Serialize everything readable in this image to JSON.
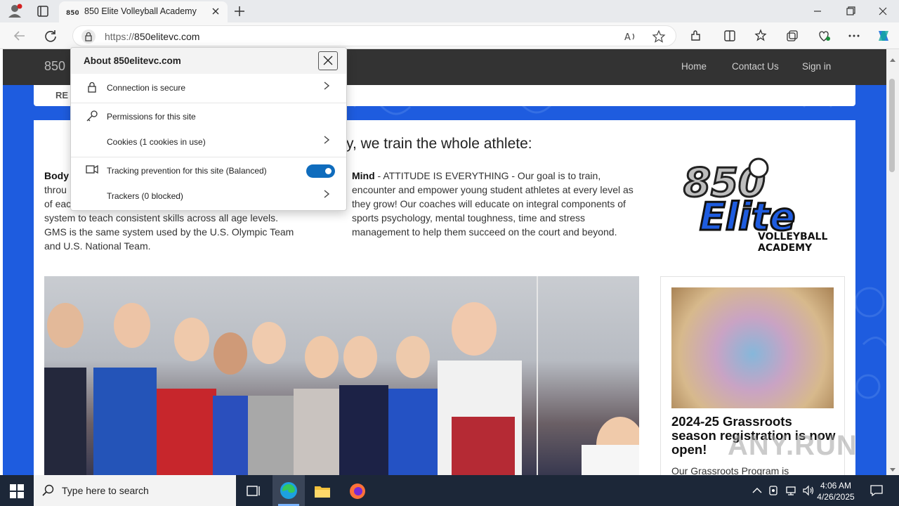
{
  "browser": {
    "tab_title": "850 Elite Volleyball Academy",
    "url_proto": "https://",
    "url_host": "850elitevc.com"
  },
  "site": {
    "brand": "850",
    "nav": [
      "Home",
      "Contact Us",
      "Sign in"
    ],
    "subbar_text": "RE",
    "headline": "y, we train the whole athlete:",
    "body_col": {
      "bold": "Body",
      "lines": [
        "throu",
        "of eac",
        "system to teach consistent skills across all age levels.",
        "GMS is the same system used by the U.S. Olympic Team",
        "and U.S. National Team."
      ]
    },
    "mind_col": {
      "bold": "Mind",
      "text": " - ATTITUDE IS EVERYTHING - Our goal is to train, encounter and empower young student athletes at every level as they grow! Our coaches will educate on integral components of sports psychology, mental toughness, time and stress management to help them succeed on the court and beyond."
    },
    "logo": {
      "line1": "850",
      "line2": "Elite",
      "line3": "VOLLEYBALL",
      "line4": "ACADEMY"
    },
    "card": {
      "title": "2024-25 Grassroots season registration is now open!",
      "text": "Our Grassroots Program is"
    }
  },
  "popup": {
    "title": "About 850elitevc.com",
    "rows": [
      {
        "label": "Connection is secure",
        "icon": "lock-icon"
      },
      {
        "label": "Permissions for this site",
        "icon": "key-icon"
      },
      {
        "label": "Cookies (1 cookies in use)",
        "icon": ""
      },
      {
        "label": "Tracking prevention for this site (Balanced)",
        "icon": "tracking-icon",
        "toggle": true
      },
      {
        "label": "Trackers (0 blocked)",
        "icon": ""
      }
    ]
  },
  "taskbar": {
    "search_placeholder": "Type here to search",
    "time": "4:06 AM",
    "date": "4/26/2025"
  },
  "watermark": "ANY.RUN",
  "colors": {
    "accent": "#1e5cdf",
    "navbar": "#333333",
    "toggle": "#0f6cbd"
  }
}
